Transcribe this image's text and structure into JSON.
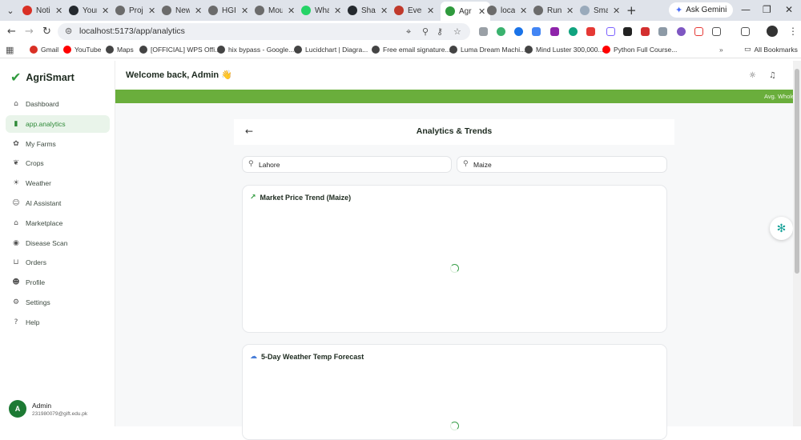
{
  "browser": {
    "tabs": [
      {
        "title": "Noti",
        "icon": "gmail-icon",
        "color": "#d93025"
      },
      {
        "title": "Your",
        "icon": "github-icon",
        "color": "#24292e"
      },
      {
        "title": "Proj",
        "icon": "web-icon",
        "color": "#6b6b6b"
      },
      {
        "title": "New",
        "icon": "web-icon",
        "color": "#6b6b6b"
      },
      {
        "title": "HGI",
        "icon": "web-icon",
        "color": "#6b6b6b"
      },
      {
        "title": "Mou",
        "icon": "web-icon",
        "color": "#6b6b6b"
      },
      {
        "title": "Wha",
        "icon": "whatsapp-icon",
        "color": "#25d366"
      },
      {
        "title": "Sha",
        "icon": "github-icon",
        "color": "#24292e"
      },
      {
        "title": "Ever",
        "icon": "web-icon",
        "color": "#c0392b"
      },
      {
        "title": "Agr",
        "icon": "agrismart-icon",
        "color": "#2f9a3d",
        "active": true
      },
      {
        "title": "loca",
        "icon": "web-icon",
        "color": "#6b6b6b"
      },
      {
        "title": "Run",
        "icon": "web-icon",
        "color": "#6b6b6b"
      },
      {
        "title": "Sma",
        "icon": "web-icon",
        "color": "#9ab"
      }
    ],
    "ask_gemini": "Ask Gemini",
    "url": "localhost:5173/app/analytics",
    "bookmarks": [
      {
        "label": "Gmail",
        "color": "#d93025"
      },
      {
        "label": "YouTube",
        "color": "#ff0000"
      },
      {
        "label": "Maps",
        "color": "#444"
      },
      {
        "label": "[OFFICIAL] WPS Offi...",
        "color": "#444"
      },
      {
        "label": "hix bypass - Google...",
        "color": "#444"
      },
      {
        "label": "Lucidchart | Diagra...",
        "color": "#444"
      },
      {
        "label": "Free email signature...",
        "color": "#444"
      },
      {
        "label": "Luma Dream Machi...",
        "color": "#444"
      },
      {
        "label": "Mind Luster 300,000...",
        "color": "#444"
      },
      {
        "label": "Python Full Course...",
        "color": "#ff0000"
      }
    ],
    "all_bookmarks": "All Bookmarks"
  },
  "app": {
    "brand": "AgriSmart",
    "nav": [
      {
        "label": "Dashboard",
        "icon": "home-icon",
        "glyph": "⌂"
      },
      {
        "label": "app.analytics",
        "icon": "bar-chart-icon",
        "glyph": "▮",
        "active": true
      },
      {
        "label": "My Farms",
        "icon": "sprout-icon",
        "glyph": "✿"
      },
      {
        "label": "Crops",
        "icon": "leaf-icon",
        "glyph": "❦"
      },
      {
        "label": "Weather",
        "icon": "sun-icon",
        "glyph": "☀"
      },
      {
        "label": "AI Assistant",
        "icon": "bot-icon",
        "glyph": "☺"
      },
      {
        "label": "Marketplace",
        "icon": "store-icon",
        "glyph": "⌂"
      },
      {
        "label": "Disease Scan",
        "icon": "camera-icon",
        "glyph": "◉"
      },
      {
        "label": "Orders",
        "icon": "cart-icon",
        "glyph": "⊔"
      },
      {
        "label": "Profile",
        "icon": "user-icon",
        "glyph": "☻"
      },
      {
        "label": "Settings",
        "icon": "gear-icon",
        "glyph": "⚙"
      },
      {
        "label": "Help",
        "icon": "help-icon",
        "glyph": "?"
      }
    ],
    "user": {
      "initial": "A",
      "name": "Admin",
      "email": "231980079@gift.edu.pk"
    },
    "welcome": "Welcome back, Admin 👋",
    "ticker": "Avg. Whole",
    "page_title": "Analytics & Trends",
    "city_input": "Lahore",
    "crop_input": "Maize",
    "market_card_title": "Market Price Trend (Maize)",
    "weather_card_title": "5-Day Weather Temp Forecast"
  },
  "colors": {
    "brand": "#2f9a3d",
    "ticker": "#6aae3c",
    "active_nav_bg": "#e9f4ea"
  }
}
